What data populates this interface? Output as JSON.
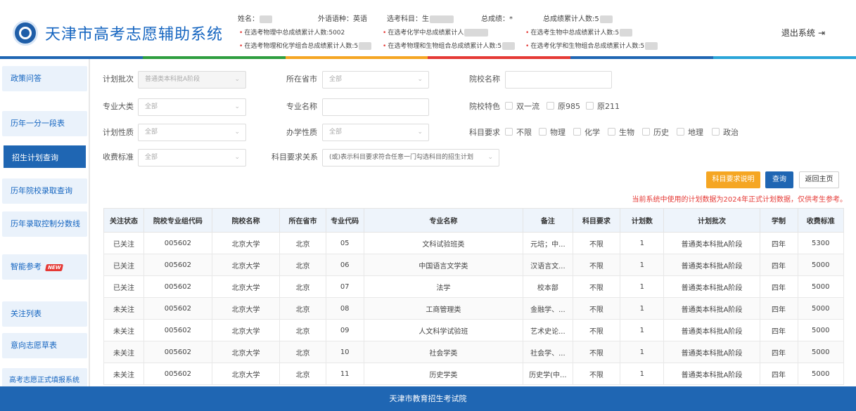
{
  "header": {
    "title": "天津市高考志愿辅助系统",
    "info": {
      "name": "姓名：",
      "language": "外语语种：英语",
      "subjects": "选考科目：生",
      "total": "总成绩：*",
      "cumulative": "总成绩累计人数:5"
    },
    "stats_row1": [
      "在选考物理中总成绩累计人数:5002",
      "在选考化学中总成绩累计人",
      "在选考生物中总成绩累计人数:5"
    ],
    "stats_row2": [
      "在选考物理和化学组合总成绩累计人数:5",
      "在选考物理和生物组合总成绩累计人数:5",
      "在选考化学和生物组合总成绩累计人数:5"
    ],
    "logout": "退出系统"
  },
  "colors": {
    "brand": "#1f66b3",
    "danger": "#e53935",
    "warning": "#f5a623",
    "stripe": [
      "#1f66b3",
      "#2e9e3f",
      "#f5a623",
      "#e53935",
      "#1f66b3",
      "#2aa5d8"
    ]
  },
  "sidebar": {
    "items": [
      {
        "label": "政策问答"
      },
      {
        "label": "历年一分一段表"
      },
      {
        "label": "招生计划查询"
      },
      {
        "label": "历年院校录取查询"
      },
      {
        "label": "历年录取控制分数线"
      },
      {
        "label": "智能参考",
        "badge": "NEW"
      },
      {
        "label": "关注列表"
      },
      {
        "label": "意向志愿草表"
      },
      {
        "label": "高考志愿正式填报系统"
      }
    ]
  },
  "filters": {
    "plan_batch": {
      "label": "计划批次",
      "value": "普通类本科批A阶段"
    },
    "province": {
      "label": "所在省市",
      "value": "全部"
    },
    "school_name": {
      "label": "院校名称",
      "value": ""
    },
    "major_category": {
      "label": "专业大类",
      "value": "全部"
    },
    "major_name": {
      "label": "专业名称",
      "value": ""
    },
    "school_feature": {
      "label": "院校特色",
      "options": [
        "双一流",
        "原985",
        "原211"
      ]
    },
    "plan_nature": {
      "label": "计划性质",
      "value": "全部"
    },
    "run_nature": {
      "label": "办学性质",
      "value": "全部"
    },
    "subject_req": {
      "label": "科目要求",
      "options": [
        "不限",
        "物理",
        "化学",
        "生物",
        "历史",
        "地理",
        "政治"
      ]
    },
    "fee": {
      "label": "收费标准",
      "value": "全部"
    },
    "subject_relation": {
      "label": "科目要求关系",
      "value": "(或)表示科目要求符合任意一门勾选科目的招生计划"
    }
  },
  "buttons": {
    "explain": "科目要求说明",
    "query": "查询",
    "home": "返回主页"
  },
  "notice": "当前系统中使用的计划数据为2024年正式计划数据，仅供考生参考。",
  "table": {
    "columns": [
      "关注状态",
      "院校专业组代码",
      "院校名称",
      "所在省市",
      "专业代码",
      "专业名称",
      "备注",
      "科目要求",
      "计划数",
      "计划批次",
      "学制",
      "收费标准"
    ],
    "rows": [
      [
        "已关注",
        "005602",
        "北京大学",
        "北京",
        "05",
        "文科试验班类",
        "元培；中...",
        "不限",
        "1",
        "普通类本科批A阶段",
        "四年",
        "5300"
      ],
      [
        "已关注",
        "005602",
        "北京大学",
        "北京",
        "06",
        "中国语言文学类",
        "汉语言文...",
        "不限",
        "1",
        "普通类本科批A阶段",
        "四年",
        "5000"
      ],
      [
        "已关注",
        "005602",
        "北京大学",
        "北京",
        "07",
        "法学",
        "校本部",
        "不限",
        "1",
        "普通类本科批A阶段",
        "四年",
        "5000"
      ],
      [
        "未关注",
        "005602",
        "北京大学",
        "北京",
        "08",
        "工商管理类",
        "金融学、...",
        "不限",
        "1",
        "普通类本科批A阶段",
        "四年",
        "5000"
      ],
      [
        "未关注",
        "005602",
        "北京大学",
        "北京",
        "09",
        "人文科学试验班",
        "艺术史论...",
        "不限",
        "1",
        "普通类本科批A阶段",
        "四年",
        "5000"
      ],
      [
        "未关注",
        "005602",
        "北京大学",
        "北京",
        "10",
        "社会学类",
        "社会学、...",
        "不限",
        "1",
        "普通类本科批A阶段",
        "四年",
        "5000"
      ],
      [
        "未关注",
        "005602",
        "北京大学",
        "北京",
        "11",
        "历史学类",
        "历史学(中...",
        "不限",
        "1",
        "普通类本科批A阶段",
        "四年",
        "5000"
      ]
    ]
  },
  "footer": "天津市教育招生考试院"
}
